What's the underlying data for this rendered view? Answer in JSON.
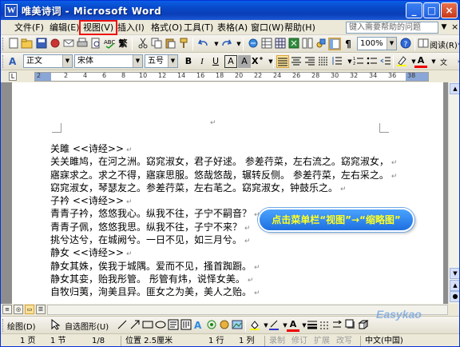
{
  "window": {
    "title": "唯美诗词 - Microsoft Word",
    "buttons": {
      "minimize": "_",
      "maximize": "□",
      "close": "×"
    }
  },
  "menubar": {
    "items": [
      {
        "label": "文件(F)"
      },
      {
        "label": "编辑(E)"
      },
      {
        "label": "视图(V)",
        "active": true
      },
      {
        "label": "插入(I)"
      },
      {
        "label": "格式(O)"
      },
      {
        "label": "工具(T)"
      },
      {
        "label": "表格(A)"
      },
      {
        "label": "窗口(W)"
      },
      {
        "label": "帮助(H)"
      }
    ],
    "help_placeholder": "键入需要帮助的问题",
    "close_doc": "×"
  },
  "toolbar_standard": {
    "zoom": "100%",
    "read_label": "阅读(R)",
    "traditional_label": "繁"
  },
  "toolbar_format": {
    "style": "正文",
    "font": "宋体",
    "size": "五号",
    "bold": "B",
    "italic": "I",
    "underline": "U",
    "char_border": "A",
    "char_shade": "A",
    "font_color": "A"
  },
  "ruler": {
    "numbers": [
      "2",
      "2",
      "4",
      "6",
      "8",
      "10",
      "12",
      "14",
      "16",
      "18",
      "20",
      "22",
      "24",
      "26",
      "28",
      "30",
      "32",
      "34",
      "36",
      "38"
    ]
  },
  "document": {
    "top_mark": "↵",
    "lines": [
      "关雎 <<诗经>>",
      "关关雎鸠，在河之洲。窈窕淑女，君子好逑。 参差荇菜，左右流之。窈窕淑女，",
      "寤寐求之。求之不得，寤寐思服。悠哉悠哉，辗转反侧。 参差荇菜，左右采之。",
      "窈窕淑女，琴瑟友之。参差荇菜，左右芼之。窈窕淑女，钟鼓乐之。",
      "子衿 <<诗经>>",
      "青青子衿，悠悠我心。纵我不往，子宁不嗣音？",
      "青青子佩，悠悠我思。纵我不往，子宁不来？",
      "挑兮达兮，在城阙兮。一日不见，如三月兮。",
      "静女 <<诗经>>",
      "静女其姝，俟我于城隅。爱而不见，搔首踟蹰。",
      "静女其娈，贻我彤管。 彤管有炜，说怿女美。",
      "自牧归荑，洵美且异。匪女之为美，美人之贻。",
      ""
    ],
    "para_mark": "↵"
  },
  "callout": {
    "text": "点击菜单栏“视图”→“缩略图”"
  },
  "drawing_toolbar": {
    "draw_label": "绘图(D)",
    "autoshape_label": "自选图形(U)"
  },
  "statusbar": {
    "page": "1 页",
    "section": "1 节",
    "pages": "1/8",
    "position": "位置 2.5厘米",
    "line": "1 行",
    "column": "1 列",
    "rec": "录制",
    "trk": "修订",
    "ext": "扩展",
    "ovr": "改写",
    "language": "中文(中国)"
  },
  "watermark": "Easykao"
}
